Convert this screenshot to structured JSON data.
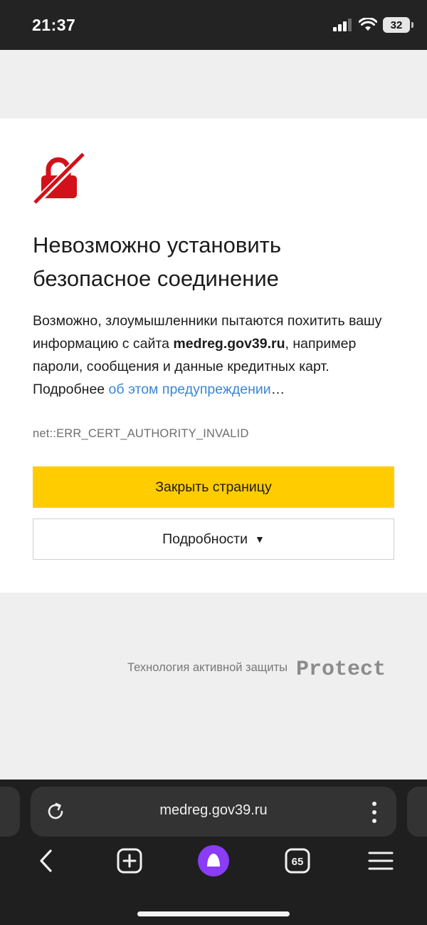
{
  "status_bar": {
    "time": "21:37",
    "battery": "32"
  },
  "error_page": {
    "title_line1": "Невозможно установить",
    "title_line2": "безопасное соединение",
    "desc_part1": "Возможно, злоумышленники пытаются похитить вашу информацию с сайта ",
    "desc_site": "medreg.gov39.ru",
    "desc_part2": ", например пароли, сообщения и данные кредитных карт. Подробнее ",
    "desc_link": "об этом предупреждении",
    "desc_ellipsis": "…",
    "error_code": "net::ERR_CERT_AUTHORITY_INVALID",
    "close_button": "Закрыть страницу",
    "details_button": "Подробности",
    "details_caret": "▼"
  },
  "protect": {
    "caption": "Технология активной защиты",
    "logo_text": "Protect"
  },
  "browser": {
    "url": "medreg.gov39.ru",
    "tabs_count": "65"
  },
  "colors": {
    "accent_yellow": "#ffcc00",
    "link_blue": "#3a86d6",
    "error_red": "#d2111a",
    "alice_purple": "#8a3cf7"
  }
}
